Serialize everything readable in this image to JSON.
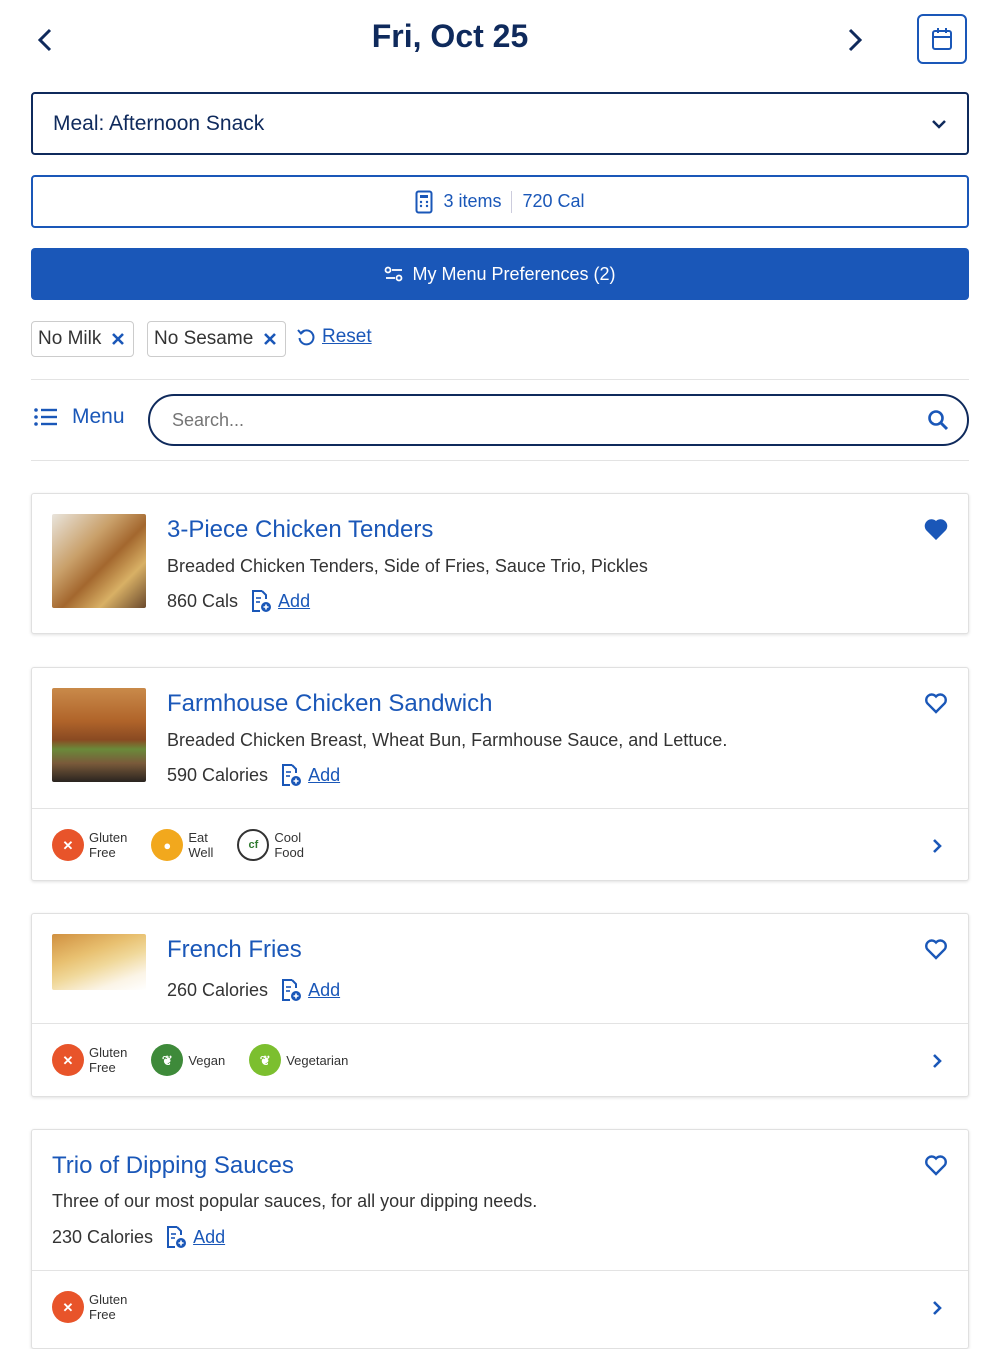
{
  "header": {
    "date": "Fri, Oct 25"
  },
  "meal_select": {
    "value": "Meal: Afternoon Snack"
  },
  "summary": {
    "items": "3 items",
    "calories": "720 Cal"
  },
  "preferences": {
    "label": "My Menu Preferences (2)"
  },
  "filters": [
    {
      "label": "No Milk"
    },
    {
      "label": "No Sesame"
    }
  ],
  "reset_label": "Reset",
  "menu_label": "Menu",
  "search": {
    "placeholder": "Search..."
  },
  "items": [
    {
      "title": "3-Piece Chicken Tenders",
      "description": "Breaded Chicken Tenders, Side of Fries, Sauce Trio, Pickles",
      "calories": "860 Cals",
      "add": "Add",
      "favorited": true
    },
    {
      "title": "Farmhouse Chicken Sandwich",
      "description": "Breaded Chicken Breast, Wheat Bun, Farmhouse Sauce, and Lettuce.",
      "calories": "590 Calories",
      "add": "Add",
      "favorited": false,
      "badges": [
        {
          "line1": "Gluten",
          "line2": "Free"
        },
        {
          "line1": "Eat",
          "line2": "Well"
        },
        {
          "line1": "Cool",
          "line2": "Food"
        }
      ]
    },
    {
      "title": "French Fries",
      "calories": "260 Calories",
      "add": "Add",
      "favorited": false,
      "badges": [
        {
          "line1": "Gluten",
          "line2": "Free"
        },
        {
          "line1": "Vegan"
        },
        {
          "line1": "Vegetarian"
        }
      ]
    },
    {
      "title": "Trio of Dipping Sauces",
      "description": "Three of our most popular sauces, for all your dipping needs.",
      "calories": "230 Calories",
      "add": "Add",
      "favorited": false,
      "badges": [
        {
          "line1": "Gluten",
          "line2": "Free"
        }
      ]
    }
  ],
  "colors": {
    "brand_blue": "#1a57b8",
    "navy": "#0f2a5c",
    "gluten_free": "#e8542a",
    "eat_well": "#f2a81d",
    "vegan": "#3e8a3a",
    "vegetarian": "#7cbf2f"
  }
}
